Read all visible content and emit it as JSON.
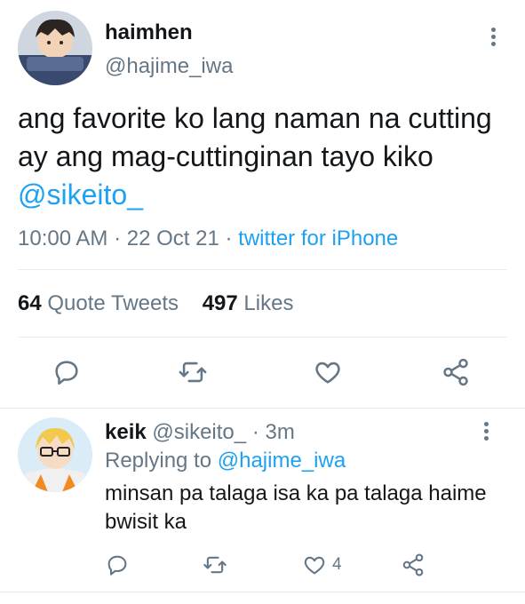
{
  "tweet": {
    "display_name": "haimhen",
    "handle": "@hajime_iwa",
    "text_before": "ang favorite ko lang naman na cutting ay ang mag-cuttinginan tayo kiko ",
    "mention": "@sikeito_",
    "time": "10:00 AM",
    "date": "22 Oct 21",
    "separator": "·",
    "source": "twitter for iPhone",
    "quote_tweets_count": "64",
    "quote_tweets_label": "Quote Tweets",
    "likes_count": "497",
    "likes_label": "Likes",
    "actions": [
      "reply-icon",
      "retweet-icon",
      "like-icon",
      "share-icon"
    ]
  },
  "reply": {
    "display_name": "keik",
    "handle": "@sikeito_",
    "separator": "·",
    "age": "3m",
    "replying_label": "Replying to",
    "replying_to": "@hajime_iwa",
    "text": "minsan pa talaga isa ka pa talaga haime bwisit ka",
    "like_count": "4",
    "actions": [
      "reply-icon",
      "retweet-icon",
      "like-icon",
      "share-icon"
    ]
  },
  "colors": {
    "accent": "#1da1f2",
    "secondary_text": "#657786",
    "primary_text": "#14171a",
    "divider": "#e6ecf0"
  }
}
